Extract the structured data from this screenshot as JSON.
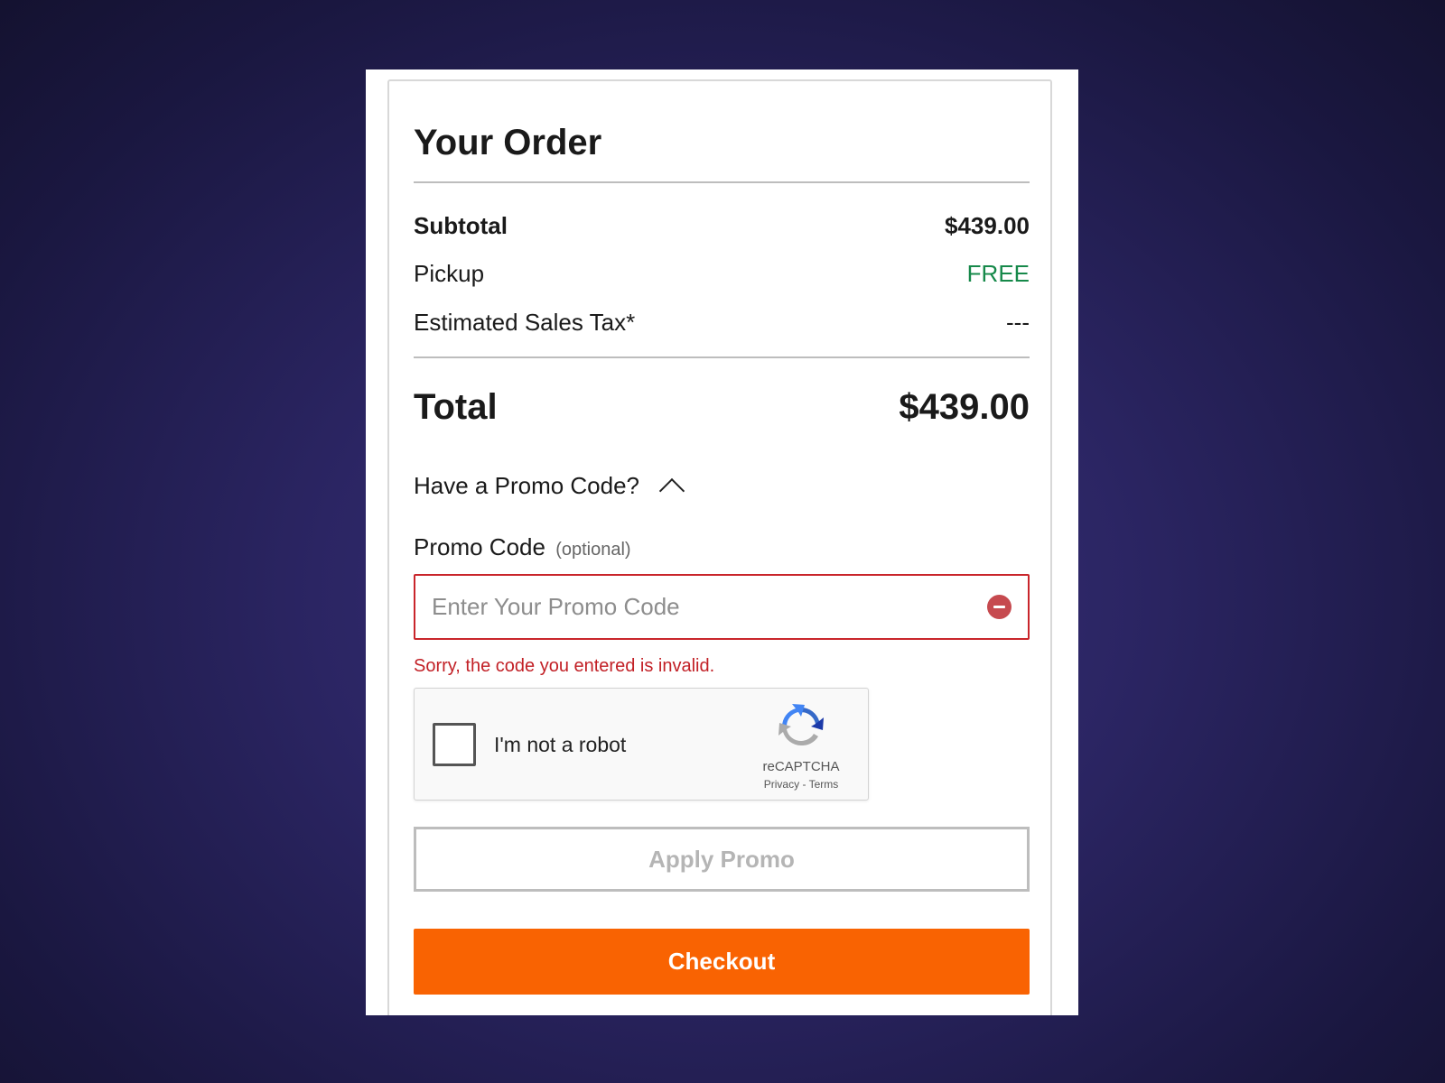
{
  "order": {
    "title": "Your Order",
    "subtotal_label": "Subtotal",
    "subtotal_value": "$439.00",
    "pickup_label": "Pickup",
    "pickup_value": "FREE",
    "tax_label": "Estimated Sales Tax*",
    "tax_value": "---",
    "total_label": "Total",
    "total_value": "$439.00"
  },
  "promo": {
    "toggle_label": "Have a Promo Code?",
    "toggle_icon": "chevron-up-icon",
    "field_label": "Promo Code",
    "field_optional": "(optional)",
    "placeholder": "Enter Your Promo Code",
    "value": "",
    "clear_icon": "minus-circle-icon",
    "error_message": "Sorry, the code you entered is invalid.",
    "apply_label": "Apply Promo"
  },
  "captcha": {
    "label": "I'm not a robot",
    "brand": "reCAPTCHA",
    "privacy": "Privacy",
    "separator": "-",
    "terms": "Terms",
    "checked": false
  },
  "checkout": {
    "label": "Checkout"
  },
  "colors": {
    "accent": "#f96302",
    "free": "#16894a",
    "error": "#c22026",
    "background": "#2b2563"
  }
}
